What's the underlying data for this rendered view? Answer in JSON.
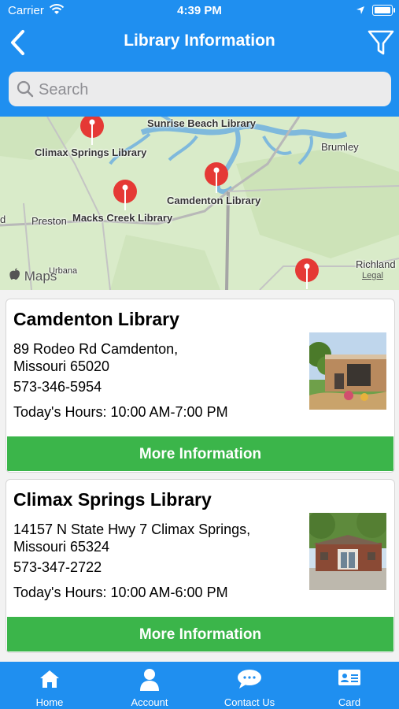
{
  "status": {
    "carrier": "Carrier",
    "time": "4:39 PM"
  },
  "nav": {
    "title": "Library Information",
    "back_icon": "chevron-left-icon",
    "filter_icon": "filter-icon"
  },
  "search": {
    "placeholder": "Search",
    "value": ""
  },
  "map": {
    "labels": {
      "sunrise_beach": "Sunrise Beach Library",
      "climax_springs": "Climax Springs Library",
      "brumley": "Brumley",
      "camdenton": "Camdenton Library",
      "macks_creek": "Macks Creek Library",
      "preston": "Preston",
      "d": "d",
      "urbana": "Urbana",
      "richland": "Richland",
      "legal": "Legal",
      "maps_logo": "Maps"
    },
    "pin_color": "#e53935",
    "water_color": "#7fb9dc",
    "land_color": "#d9ebc9"
  },
  "libraries": [
    {
      "name": "Camdenton Library",
      "address": "89 Rodeo Rd  Camdenton,\nMissouri 65020",
      "phone": "573-346-5954",
      "hours": "Today's Hours:  10:00 AM-7:00 PM",
      "more_label": "More Information"
    },
    {
      "name": "Climax Springs Library",
      "address": "14157 N State Hwy 7  Climax Springs,\nMissouri 65324",
      "phone": "573-347-2722",
      "hours": "Today's Hours:  10:00 AM-6:00 PM",
      "more_label": "More Information"
    }
  ],
  "tabs": [
    {
      "label": "Home",
      "icon": "home-icon"
    },
    {
      "label": "Account",
      "icon": "person-icon"
    },
    {
      "label": "Contact Us",
      "icon": "chat-bubble-icon"
    },
    {
      "label": "Card",
      "icon": "id-card-icon"
    }
  ],
  "colors": {
    "primary": "#1f8ff0",
    "action": "#3bb54a"
  }
}
